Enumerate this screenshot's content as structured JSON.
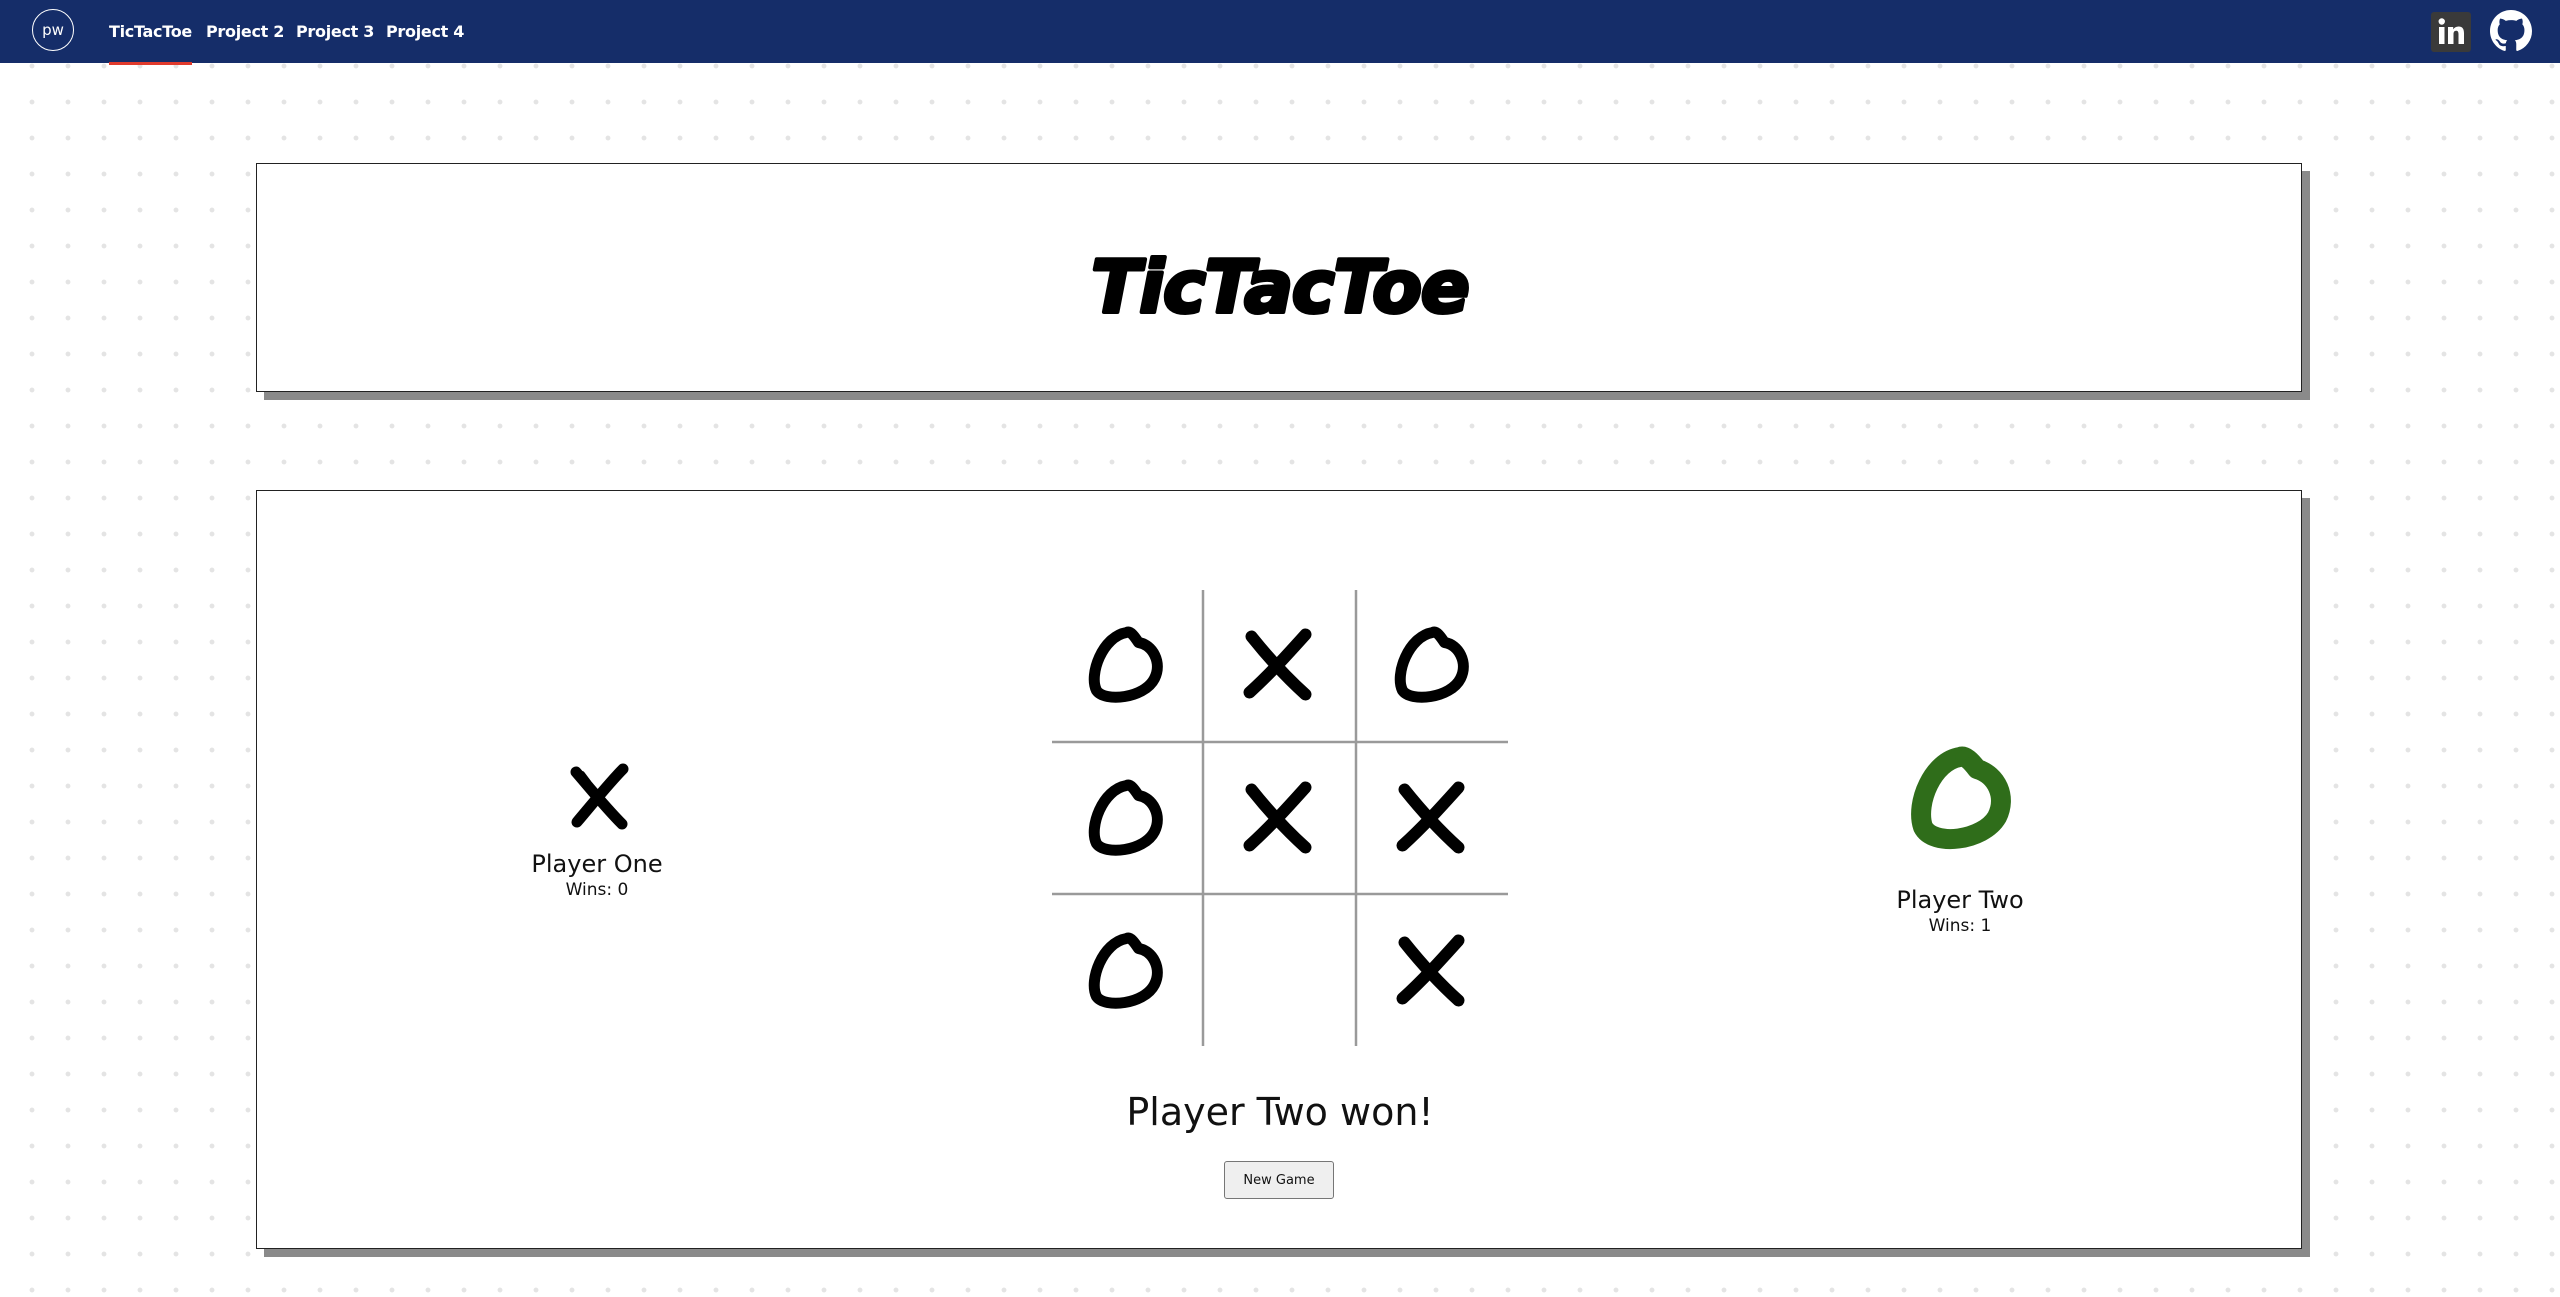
{
  "nav": {
    "brand": "pw",
    "links": [
      "TicTacToe",
      "Project 2",
      "Project 3",
      "Project 4"
    ],
    "linkedin_icon": "linkedin-icon",
    "github_icon": "github-icon",
    "colors": {
      "bar": "#152d69",
      "active_underline": "#e03a2c"
    }
  },
  "header": {
    "title": "TicTacToe"
  },
  "game": {
    "board": [
      "O",
      "X",
      "O",
      "O",
      "X",
      "X",
      "O",
      "",
      "X"
    ],
    "player_one": {
      "name": "Player One",
      "wins": "Wins: 0",
      "mark": "X",
      "color": "#000000"
    },
    "player_two": {
      "name": "Player Two",
      "wins": "Wins: 1",
      "mark": "O",
      "color": "#2f6d1a"
    },
    "status": "Player Two won!",
    "new_game_label": "New Game"
  }
}
